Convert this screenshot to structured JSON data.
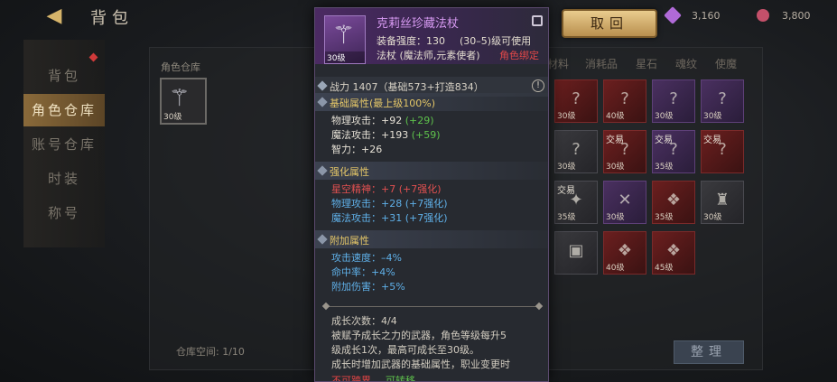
{
  "header": {
    "title": "背包",
    "back_icon": "back-arrow-icon",
    "return_label": "取回"
  },
  "currency": [
    {
      "icon": "purple-gem-icon",
      "value": "3,160"
    },
    {
      "icon": "red-coin-icon",
      "value": "3,800"
    }
  ],
  "sidebar": {
    "items": [
      {
        "label": "背包"
      },
      {
        "label": "角色仓库"
      },
      {
        "label": "账号仓库"
      },
      {
        "label": "时装"
      },
      {
        "label": "称号"
      }
    ]
  },
  "storage": {
    "label": "角色仓库",
    "selected_item_level": "30级",
    "capacity": "仓库空间: 1/10",
    "sort_label": "整理"
  },
  "category_tabs": [
    "材料",
    "消耗品",
    "星石",
    "魂纹",
    "使魔"
  ],
  "items": [
    {
      "lvl": "30级",
      "trade": ""
    },
    {
      "lvl": "40级",
      "trade": ""
    },
    {
      "lvl": "30级",
      "trade": ""
    },
    {
      "lvl": "30级",
      "trade": ""
    },
    {
      "lvl": "30级",
      "trade": ""
    },
    {
      "lvl": "30级",
      "trade": "交易"
    },
    {
      "lvl": "35级",
      "trade": "交易"
    },
    {
      "lvl": "",
      "trade": ""
    },
    {
      "lvl": "35级",
      "trade": "交易"
    },
    {
      "lvl": "30级",
      "trade": ""
    },
    {
      "lvl": "35级",
      "trade": ""
    },
    {
      "lvl": "30级",
      "trade": ""
    },
    {
      "lvl": "",
      "trade": ""
    },
    {
      "lvl": "40级",
      "trade": ""
    },
    {
      "lvl": "45级",
      "trade": ""
    }
  ],
  "tooltip": {
    "name": "克莉丝珍藏法杖",
    "icon_level": "30级",
    "enhance": "装备强度：130",
    "level_req": "(30–5)级可使用",
    "class_req": "法杖 (魔法师,元素使者)",
    "bind": "角色绑定",
    "power": "战力 1407（基础573+打造834）",
    "base_title": "基础属性(最上级100%)",
    "base_stats": [
      {
        "label": "物理攻击：+92",
        "bonus": "(+29)"
      },
      {
        "label": "魔法攻击：+193",
        "bonus": "(+59)"
      },
      {
        "label": "智力：+26",
        "bonus": ""
      }
    ],
    "enhance_title": "强化属性",
    "enhance_stats": [
      {
        "text": "星空精神：+7 (+7强化)"
      },
      {
        "text": "物理攻击：+28 (+7强化)"
      },
      {
        "text": "魔法攻击：+31 (+7强化)"
      }
    ],
    "extra_title": "附加属性",
    "extra_stats": [
      {
        "text": "攻击速度：–4%"
      },
      {
        "text": "命中率：+4%"
      },
      {
        "text": "附加伤害：+5%"
      }
    ],
    "growth": "成长次数：4/4",
    "desc": [
      "被赋予成长之力的武器，角色等级每升5",
      "级成长1次，最高可成长至30级。",
      "成长时增加武器的基础属性，职业变更时"
    ],
    "no_cross": "不可跨界",
    "transferable": "可转移"
  }
}
